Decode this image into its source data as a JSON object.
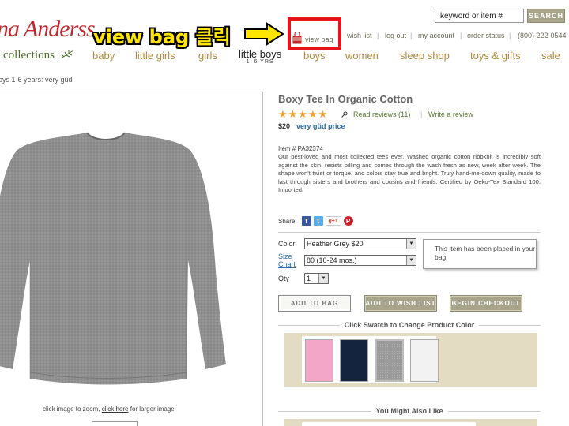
{
  "brand": {
    "logo_text": "Hanna Andersson",
    "logo_visible": "na Anderss"
  },
  "annotation": {
    "text": "view bag 클릭",
    "arrow_color": "#ffe600",
    "box_color": "#e8141c"
  },
  "search": {
    "value": "keyword or item #",
    "button": "SEARCH"
  },
  "utility": {
    "view_bag": "view bag",
    "wish_list": "wish list",
    "log_out": "log out",
    "my_account": "my account",
    "order_status": "order status",
    "phone": "(800) 222-0544"
  },
  "nav": {
    "collections": "collections",
    "baby": "baby",
    "little_girls": "little girls",
    "girls": "girls",
    "little_boys": "little boys",
    "little_boys_sub": "1–6 YRS",
    "boys": "boys",
    "women": "women",
    "sleep_shop": "sleep shop",
    "toys_gifts": "toys & gifts",
    "sale": "sale"
  },
  "breadcrumb": "oys 1-6 years:  very güd",
  "image": {
    "zoom_hint": "click image to zoom,",
    "zoom_link": "click here",
    "zoom_tail": "for larger image"
  },
  "product": {
    "title": "Boxy Tee In Organic Cotton",
    "stars": "★★★★★",
    "rating": 5,
    "reviews": "Read reviews (11)",
    "write_review": "Write a review",
    "price": "$20",
    "price_brand": "very güd price",
    "item_no": "Item # PA32374",
    "description": "Our best-loved and most collected tees ever. Washed organic cotton ribbknit is incredibly soft against the skin, resists pilling and comes through the wash fresh as new, week after week. The shape won't twist or torque, and colors stay true and bright. Truly hand-me-down quality, made to last through sisters and brothers and cousins and friends. Certified by Oeko-Tex Standard 100. Imported."
  },
  "share": {
    "label": "Share:",
    "fb": "f",
    "tw": "t",
    "gplus": "g+1",
    "pin": "P"
  },
  "options": {
    "color_label": "Color",
    "color_value": "Heather Grey  $20",
    "size_label_1": "Size",
    "size_label_2": "Chart",
    "size_value": "80 (10-24 mos.)",
    "qty_label": "Qty",
    "qty_value": "1"
  },
  "tooltip": "This item has been placed in your bag.",
  "buttons": {
    "add_to_bag": "ADD TO BAG",
    "add_to_wishlist": "ADD TO WISH LIST",
    "begin_checkout": "BEGIN CHECKOUT"
  },
  "swatches": {
    "header": "Click Swatch to Change Product Color",
    "colors": [
      "#f4a6c8",
      "#14243f",
      "#9a9a9a",
      "#f2f2f2"
    ]
  },
  "also_like": {
    "header": "You Might Also Like"
  },
  "colors": {
    "nav_gold": "#b08a3c",
    "link_green": "#557733",
    "brand_red": "#c0272d",
    "khaki": "#a8a48b"
  }
}
